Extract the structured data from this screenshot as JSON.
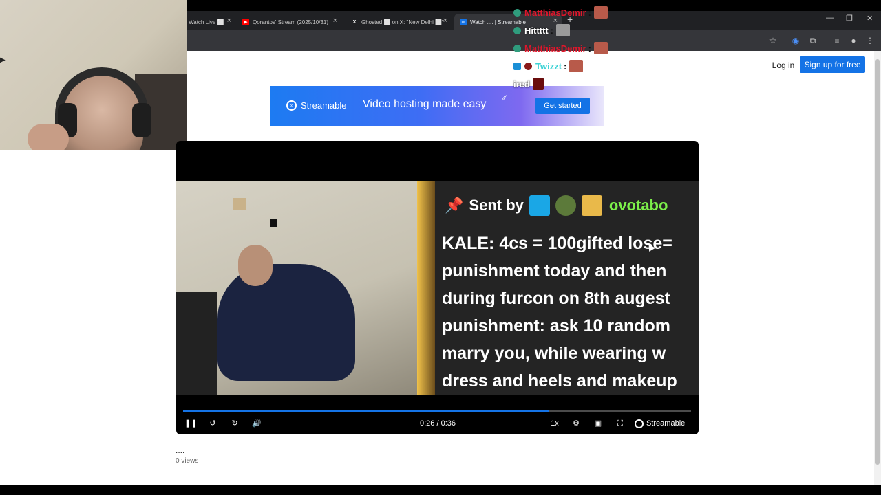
{
  "browser": {
    "tabs": [
      {
        "label": "Watch Live ⬜",
        "favicon": "kick-icon",
        "color": "#53fc18"
      },
      {
        "label": "Qorantos' Stream (2025/10/31)",
        "favicon": "youtube-icon",
        "color": "#ff0000"
      },
      {
        "label": "Ghosted ⬜ on X: \"New Delhi ⬜\"",
        "favicon": "x-icon",
        "color": "#000000"
      },
      {
        "label": "Watch .... | Streamable",
        "favicon": "streamable-icon",
        "color": "#1473e6"
      }
    ],
    "new_tab": "+",
    "window_controls": [
      "—",
      "❐",
      "✕"
    ]
  },
  "header": {
    "login_label": "Log in",
    "signup_label": "Sign up for free"
  },
  "banner": {
    "brand": "Streamable",
    "tagline": "Video hosting made easy",
    "cta": "Get started"
  },
  "chat": [
    {
      "user": "MatthiasDemir",
      "color": "#e0162b",
      "text": ""
    },
    {
      "user": "Hittttt",
      "color": "#ffffff",
      "text": ""
    },
    {
      "user": "MatthiasDemir",
      "color": "#e0162b",
      "text": ""
    },
    {
      "user": "Twizzt",
      "color": "#3ed3d6",
      "text": ""
    },
    {
      "user": "ired",
      "color": "#ffffff",
      "text": ""
    }
  ],
  "video": {
    "alert": {
      "sent_by": "Sent by",
      "username": "ovotabo",
      "message": "KALE: 4cs = 100gifted lose=\npunishment today and then\nduring furcon on 8th augest\npunishment: ask 10 random\nmarry you, while wearing w\ndress and heels and makeup"
    },
    "controls": {
      "time": "0:26 / 0:36",
      "speed": "1x",
      "brand": "Streamable",
      "progress": 0.72
    }
  },
  "meta": {
    "title": "....",
    "views": "0 views"
  }
}
